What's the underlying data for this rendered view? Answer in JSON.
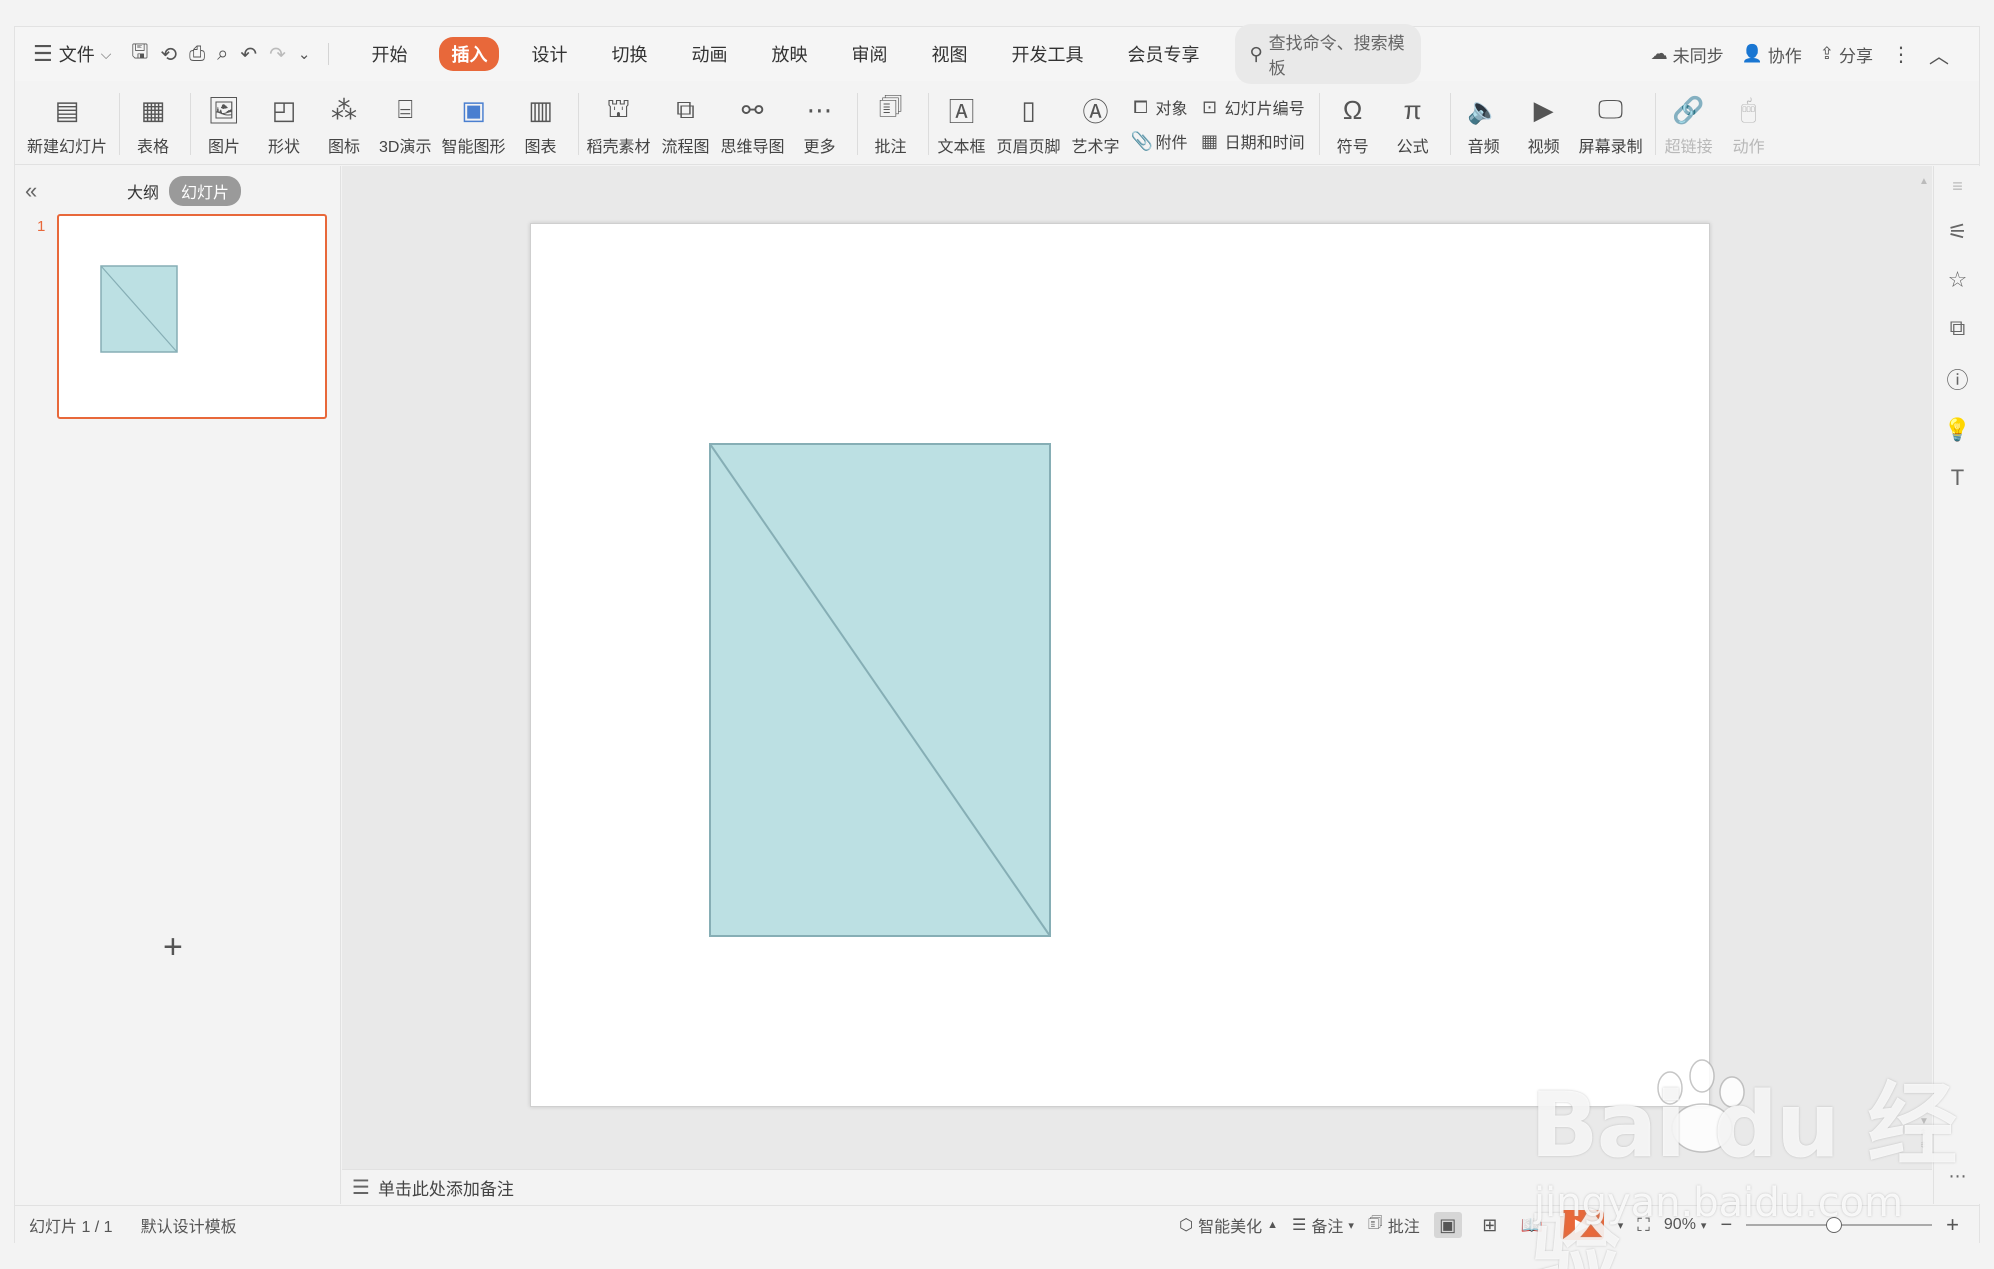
{
  "menubar": {
    "file_label": "文件",
    "tabs": [
      "开始",
      "插入",
      "设计",
      "切换",
      "动画",
      "放映",
      "审阅",
      "视图",
      "开发工具",
      "会员专享"
    ],
    "active_tab": "插入",
    "search_placeholder": "查找命令、搜索模板",
    "right": {
      "sync": "未同步",
      "collab": "协作",
      "share": "分享"
    }
  },
  "ribbon": {
    "new_slide": "新建幻灯片",
    "table": "表格",
    "picture": "图片",
    "shape": "形状",
    "icon": "图标",
    "3d": "3D演示",
    "smartart": "智能图形",
    "chart": "图表",
    "material": "稻壳素材",
    "flowchart": "流程图",
    "mindmap": "思维导图",
    "more": "更多",
    "comment": "批注",
    "textbox": "文本框",
    "header_footer": "页眉页脚",
    "wordart": "艺术字",
    "object": "对象",
    "attachment": "附件",
    "slide_number": "幻灯片编号",
    "datetime": "日期和时间",
    "symbol": "符号",
    "formula": "公式",
    "audio": "音频",
    "video": "视频",
    "screen_record": "屏幕录制",
    "hyperlink": "超链接",
    "action": "动作"
  },
  "leftpanel": {
    "outline_tab": "大纲",
    "slides_tab": "幻灯片",
    "slide_number": "1"
  },
  "notes": {
    "placeholder": "单击此处添加备注"
  },
  "statusbar": {
    "slide_info": "幻灯片 1 / 1",
    "template": "默认设计模板",
    "beautify": "智能美化",
    "notes": "备注",
    "comment": "批注",
    "zoom": "90%"
  },
  "shape": {
    "fill": "#bce0e3",
    "stroke": "#86aeb5"
  },
  "watermark": {
    "main": "Bai du 经验",
    "sub": "jingyan.baidu.com"
  }
}
